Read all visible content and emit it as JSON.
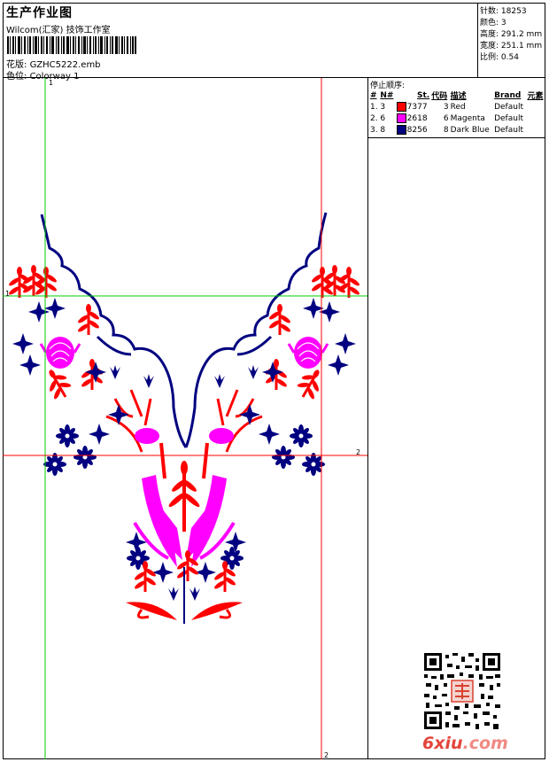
{
  "header": {
    "title": "生产作业图",
    "subtitle": "Wilcom(汇家) 技饰工作室",
    "design_label": "花版:",
    "design_value": "GZHC5222.emb",
    "colorway_label": "色位:",
    "colorway_value": "Colorway 1"
  },
  "specs": [
    {
      "label": "针数:",
      "value": "18253"
    },
    {
      "label": "颜色:",
      "value": "3"
    },
    {
      "label": "高度:",
      "value": "291.2 mm"
    },
    {
      "label": "宽度:",
      "value": "251.1 mm"
    },
    {
      "label": "比例:",
      "value": "0.54"
    }
  ],
  "stop_sequence": {
    "title": "停止顺序:",
    "headers": [
      "#",
      "N#",
      "St.",
      "代码",
      "描述",
      "Brand",
      "元素"
    ],
    "rows": [
      {
        "idx": "1.",
        "n": "3",
        "color": "#ff0000",
        "st": "7377",
        "code": "3",
        "desc": "Red",
        "brand": "Default"
      },
      {
        "idx": "2.",
        "n": "6",
        "color": "#ff00ff",
        "st": "2618",
        "code": "6",
        "desc": "Magenta",
        "brand": "Default"
      },
      {
        "idx": "3.",
        "n": "8",
        "color": "#000080",
        "st": "8256",
        "code": "8",
        "desc": "Dark Blue",
        "brand": "Default"
      }
    ]
  },
  "guides": {
    "marker_1": "1",
    "marker_2": "2"
  },
  "colors": {
    "red": "#ff0000",
    "magenta": "#ff00ff",
    "blue": "#000080",
    "guide_green": "#00cc00",
    "guide_red": "#ff0000"
  },
  "watermark": {
    "site": "6xiu",
    "tld": ".com"
  }
}
